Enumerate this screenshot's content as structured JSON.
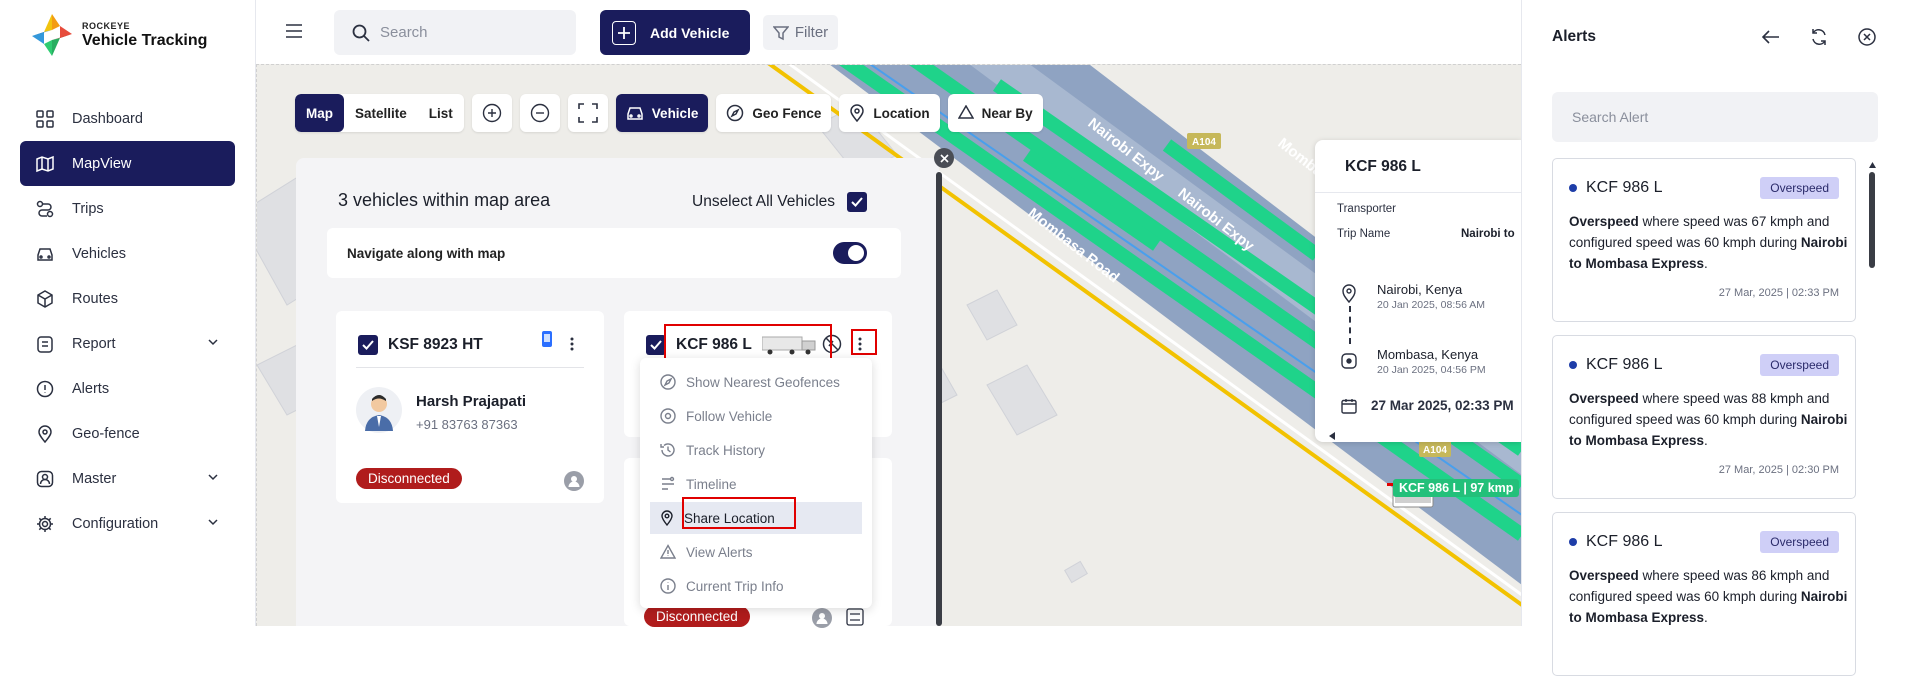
{
  "brand": {
    "small": "ROCKEYE",
    "name": "Vehicle Tracking"
  },
  "nav": [
    {
      "label": "Dashboard"
    },
    {
      "label": "MapView",
      "active": true
    },
    {
      "label": "Trips"
    },
    {
      "label": "Vehicles"
    },
    {
      "label": "Routes"
    },
    {
      "label": "Report",
      "expandable": true
    },
    {
      "label": "Alerts"
    },
    {
      "label": "Geo-fence"
    },
    {
      "label": "Master",
      "expandable": true
    },
    {
      "label": "Configuration",
      "expandable": true
    }
  ],
  "topbar": {
    "search_placeholder": "Search",
    "add_vehicle": "Add Vehicle",
    "filter": "Filter"
  },
  "map_controls": {
    "map": "Map",
    "satellite": "Satellite",
    "list": "List",
    "vehicle": "Vehicle",
    "geo_fence": "Geo Fence",
    "location": "Location",
    "near_by": "Near By"
  },
  "map_labels": {
    "road1": "Nairobi Expy",
    "road2": "Nairobi Expy",
    "road3": "Mombasa Road",
    "road4": "Momba",
    "shield1": "A104",
    "shield2": "A104",
    "vehicle_tag": "KCF 986 L | 97 kmp"
  },
  "panel": {
    "heading": "3 vehicles within map area",
    "unselect_all": "Unselect All Vehicles",
    "navigate_label": "Navigate along with map",
    "navigate_on": true
  },
  "cards": [
    {
      "plate": "KSF 8923 HT",
      "driver": "Harsh Prajapati",
      "phone": "+91 83763 87363",
      "status": "Disconnected"
    },
    {
      "plate": "KCF 986 L"
    },
    {
      "status": "Disconnected"
    }
  ],
  "context_menu": [
    {
      "label": "Show Nearest Geofences",
      "icon": "compass-icon"
    },
    {
      "label": "Follow Vehicle",
      "icon": "follow-icon"
    },
    {
      "label": "Track History",
      "icon": "history-icon"
    },
    {
      "label": "Timeline",
      "icon": "timeline-icon"
    },
    {
      "label": "Share Location",
      "icon": "location-pin-icon",
      "highlighted": true
    },
    {
      "label": "View Alerts",
      "icon": "warning-icon"
    },
    {
      "label": "Current Trip Info",
      "icon": "info-icon"
    }
  ],
  "popup": {
    "plate": "KCF 986 L",
    "transporter_label": "Transporter",
    "trip_name_label": "Trip Name",
    "trip_name_value": "Nairobi to",
    "from_place": "Nairobi, Kenya",
    "from_time": "20 Jan 2025, 08:56 AM",
    "to_place": "Mombasa, Kenya",
    "to_time": "20 Jan 2025, 04:56 PM",
    "date": "27 Mar 2025, 02:33 PM"
  },
  "alerts_panel": {
    "title": "Alerts",
    "search_placeholder": "Search Alert",
    "items": [
      {
        "vehicle": "KCF 986 L",
        "tag": "Overspeed",
        "bold": "Overspeed",
        "text": " where speed was 67 kmph and configured speed was 60 kmph during ",
        "trip": "Nairobi to Mombasa Express",
        "end": ".",
        "time": "27 Mar, 2025 | 02:33 PM"
      },
      {
        "vehicle": "KCF 986 L",
        "tag": "Overspeed",
        "bold": "Overspeed",
        "text": " where speed was 88 kmph and configured speed was 60 kmph during ",
        "trip": "Nairobi to Mombasa Express",
        "end": ".",
        "time": "27 Mar, 2025 | 02:30 PM"
      },
      {
        "vehicle": "KCF 986 L",
        "tag": "Overspeed",
        "bold": "Overspeed",
        "text": " where speed was 86 kmph and configured speed was 60 kmph during ",
        "trip": "Nairobi to Mombasa Express",
        "end": ".",
        "time": ""
      }
    ]
  },
  "colors": {
    "primary": "#1a1c5c",
    "danger": "#b01c1c",
    "highlight": "#e00000",
    "road_green": "#1fd38a",
    "road_blue": "#8fa3c2",
    "road_yellow": "#f2c200"
  }
}
